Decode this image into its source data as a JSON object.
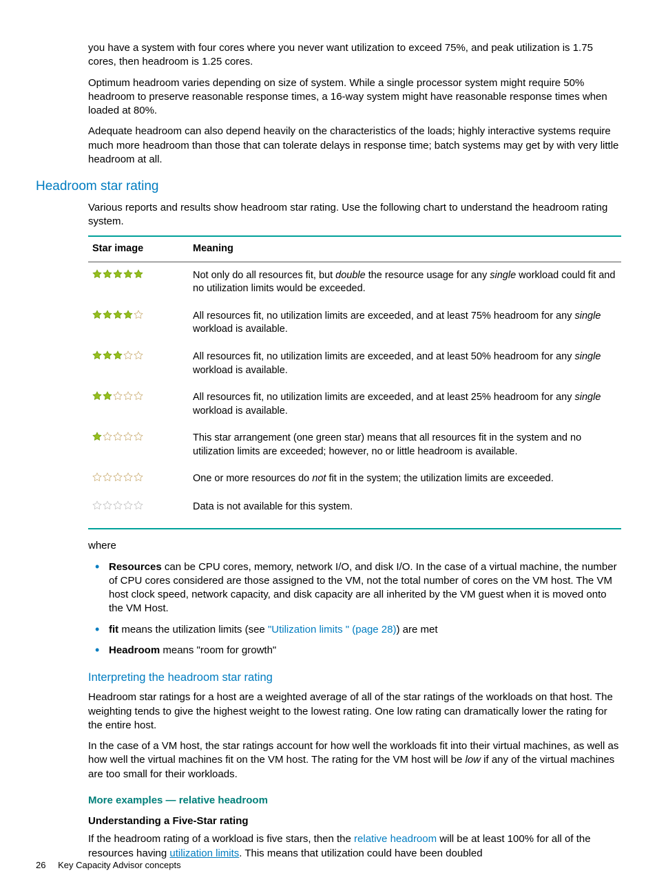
{
  "intro": {
    "p1": "you have a system with four cores where you never want utilization to exceed 75%, and peak utilization is 1.75 cores, then headroom is 1.25 cores.",
    "p2": "Optimum headroom varies depending on size of system. While a single processor system might require 50% headroom to preserve reasonable response times, a 16-way system might have reasonable response times when loaded at 80%.",
    "p3": "Adequate headroom can also depend heavily on the characteristics of the loads; highly interactive systems require much more headroom than those that can tolerate delays in response time; batch systems may get by with very little headroom at all."
  },
  "section_heading": "Headroom star rating",
  "section_intro": "Various reports and results show headroom star rating. Use the following chart to understand the headroom rating system.",
  "table": {
    "headers": {
      "stars": "Star image",
      "meaning": "Meaning"
    },
    "rows": [
      {
        "stars": {
          "mode": "green",
          "filled": 5
        },
        "meaning_segments": [
          {
            "t": "Not only do all resources fit, but "
          },
          {
            "t": "double",
            "i": true
          },
          {
            "t": " the resource usage for any "
          },
          {
            "t": "single",
            "i": true
          },
          {
            "t": " workload could fit and no utilization limits would be exceeded."
          }
        ]
      },
      {
        "stars": {
          "mode": "green",
          "filled": 4
        },
        "meaning_segments": [
          {
            "t": "All resources fit, no utilization limits are exceeded, and at least 75% headroom for any "
          },
          {
            "t": "single",
            "i": true
          },
          {
            "t": " workload is available."
          }
        ]
      },
      {
        "stars": {
          "mode": "green",
          "filled": 3
        },
        "meaning_segments": [
          {
            "t": "All resources fit, no utilization limits are exceeded, and at least 50% headroom for any "
          },
          {
            "t": "single",
            "i": true
          },
          {
            "t": " workload is available."
          }
        ]
      },
      {
        "stars": {
          "mode": "green",
          "filled": 2
        },
        "meaning_segments": [
          {
            "t": "All resources fit, no utilization limits are exceeded, and at least 25% headroom for any "
          },
          {
            "t": "single",
            "i": true
          },
          {
            "t": " workload is available."
          }
        ]
      },
      {
        "stars": {
          "mode": "green",
          "filled": 1
        },
        "meaning_segments": [
          {
            "t": "This star arrangement (one green star) means that all resources fit in the system and no utilization limits are exceeded; however, no or little headroom is available."
          }
        ]
      },
      {
        "stars": {
          "mode": "green",
          "filled": 0
        },
        "meaning_segments": [
          {
            "t": "One or more resources do "
          },
          {
            "t": "not",
            "i": true
          },
          {
            "t": " fit in the system; the utilization limits are exceeded."
          }
        ]
      },
      {
        "stars": {
          "mode": "grey"
        },
        "meaning_segments": [
          {
            "t": "Data is not available for this system."
          }
        ]
      }
    ]
  },
  "where_lead": "where",
  "where_items": [
    {
      "segments": [
        {
          "t": "Resources",
          "b": true
        },
        {
          "t": " can be CPU cores, memory, network I/O, and disk I/O. In the case of a virtual machine, the number of CPU cores considered are those assigned to the VM, not the total number of cores on the VM host. The VM host clock speed, network capacity, and disk capacity are all inherited by the VM guest when it is moved onto the VM Host."
        }
      ]
    },
    {
      "segments": [
        {
          "t": "fit",
          "b": true
        },
        {
          "t": " means the utilization limits (see "
        },
        {
          "t": "\"Utilization limits \" (page 28)",
          "link": true
        },
        {
          "t": ") are met"
        }
      ]
    },
    {
      "segments": [
        {
          "t": "Headroom",
          "b": true
        },
        {
          "t": " means \"room for growth\""
        }
      ]
    }
  ],
  "interp_heading": "Interpreting the headroom star rating",
  "interp_p1": "Headroom star ratings for a host are a weighted average of all of the star ratings of the workloads on that host. The weighting tends to give the highest weight to the lowest rating. One low rating can dramatically lower the rating for the entire host.",
  "interp_p2_segments": [
    {
      "t": "In the case of a VM host, the star ratings account for how well the workloads fit into their virtual machines, as well as how well the virtual machines fit on the VM host. The rating for the VM host will be "
    },
    {
      "t": "low",
      "i": true
    },
    {
      "t": " if any of the virtual machines are too small for their workloads."
    }
  ],
  "examples_heading": "More examples — relative headroom",
  "fivestar_heading": "Understanding a Five-Star rating",
  "fivestar_p_segments": [
    {
      "t": "If the headroom rating of a workload is five stars, then the "
    },
    {
      "t": "relative headroom",
      "link": true
    },
    {
      "t": " will be at least 100% for all of the resources having "
    },
    {
      "t": "utilization limits",
      "ulink": true
    },
    {
      "t": ". This means that utilization could have been doubled"
    }
  ],
  "footer": {
    "page_number": "26",
    "chapter": "Key Capacity Advisor concepts"
  },
  "colors": {
    "green": "#96bf1f",
    "green_outline": "#6c9a00",
    "outline": "#c7a86a",
    "grey_stroke": "#bcbcbc"
  }
}
